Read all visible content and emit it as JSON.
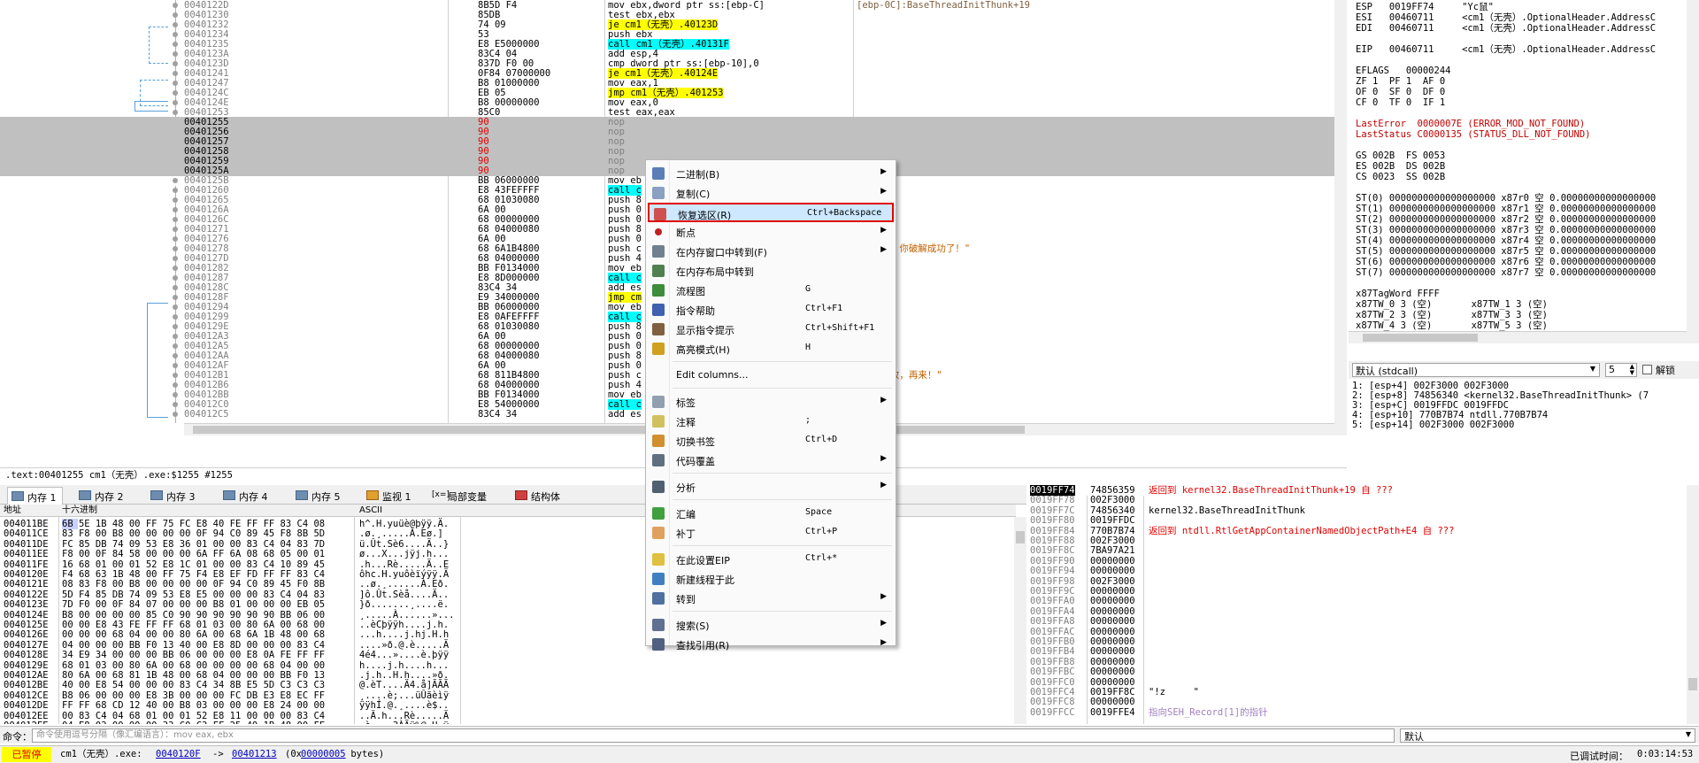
{
  "disasm": [
    {
      "addr": "0040122D",
      "hex": "8B5D F4",
      "asm": "mov ebx,dword ptr ss:[ebp-C]",
      "cmt": "[ebp-0C]:BaseThreadInitThunk+19"
    },
    {
      "addr": "00401230",
      "hex": "85DB",
      "asm": "test ebx,ebx",
      "cmt": ""
    },
    {
      "addr": "00401232",
      "hex": "74 09",
      "asm": "je cm1（无壳）.40123D",
      "cmt": ""
    },
    {
      "addr": "00401234",
      "hex": "53",
      "asm": "push ebx",
      "cmt": ""
    },
    {
      "addr": "00401235",
      "hex": "E8 E5000000",
      "asm": "call cm1（无壳）.40131F",
      "cmt": ""
    },
    {
      "addr": "0040123A",
      "hex": "83C4 04",
      "asm": "add esp,4",
      "cmt": ""
    },
    {
      "addr": "0040123D",
      "hex": "837D F0 00",
      "asm": "cmp dword ptr ss:[ebp-10],0",
      "cmt": ""
    },
    {
      "addr": "00401241",
      "hex": "0F84 07000000",
      "asm": "je cm1（无壳）.40124E",
      "cmt": ""
    },
    {
      "addr": "00401247",
      "hex": "B8 01000000",
      "asm": "mov eax,1",
      "cmt": ""
    },
    {
      "addr": "0040124C",
      "hex": "EB 05",
      "asm": "jmp cm1（无壳）.401253",
      "cmt": ""
    },
    {
      "addr": "0040124E",
      "hex": "B8 00000000",
      "asm": "mov eax,0",
      "cmt": ""
    },
    {
      "addr": "00401253",
      "hex": "85C0",
      "asm": "test eax,eax",
      "cmt": ""
    },
    {
      "addr": "00401255",
      "hex": "90",
      "asm": "nop",
      "cmt": "",
      "sel": true
    },
    {
      "addr": "00401256",
      "hex": "90",
      "asm": "nop",
      "cmt": "",
      "sel": true
    },
    {
      "addr": "00401257",
      "hex": "90",
      "asm": "nop",
      "cmt": "",
      "sel": true
    },
    {
      "addr": "00401258",
      "hex": "90",
      "asm": "nop",
      "cmt": "",
      "sel": true
    },
    {
      "addr": "00401259",
      "hex": "90",
      "asm": "nop",
      "cmt": "",
      "sel": true
    },
    {
      "addr": "0040125A",
      "hex": "90",
      "asm": "nop",
      "cmt": "",
      "sel": true
    },
    {
      "addr": "0040125B",
      "hex": "BB 06000000",
      "asm": "mov eb",
      "cmt": ""
    },
    {
      "addr": "00401260",
      "hex": "E8 43FEFFFF",
      "asm": "call c",
      "cmt": ""
    },
    {
      "addr": "00401265",
      "hex": "68 01030080",
      "asm": "push 8",
      "cmt": ""
    },
    {
      "addr": "0040126A",
      "hex": "6A 00",
      "asm": "push 0",
      "cmt": ""
    },
    {
      "addr": "0040126C",
      "hex": "68 00000000",
      "asm": "push 0",
      "cmt": ""
    },
    {
      "addr": "00401271",
      "hex": "68 04000080",
      "asm": "push 8",
      "cmt": ""
    },
    {
      "addr": "00401276",
      "hex": "6A 00",
      "asm": "push 0",
      "cmt": ""
    },
    {
      "addr": "00401278",
      "hex": "68 6A1B4800",
      "asm": "push c",
      "cmt": "\"恭喜你，你破解成功了！\""
    },
    {
      "addr": "0040127D",
      "hex": "68 04000000",
      "asm": "push 4",
      "cmt": ""
    },
    {
      "addr": "00401282",
      "hex": "BB F0134000",
      "asm": "mov eb",
      "cmt": ""
    },
    {
      "addr": "00401287",
      "hex": "E8 8D000000",
      "asm": "call c",
      "cmt": ""
    },
    {
      "addr": "0040128C",
      "hex": "83C4 34",
      "asm": "add es",
      "cmt": ""
    },
    {
      "addr": "0040128F",
      "hex": "E9 34000000",
      "asm": "jmp cm",
      "cmt": ""
    },
    {
      "addr": "00401294",
      "hex": "BB 06000000",
      "asm": "mov eb",
      "cmt": ""
    },
    {
      "addr": "00401299",
      "hex": "E8 0AFEFFFF",
      "asm": "call c",
      "cmt": ""
    },
    {
      "addr": "0040129E",
      "hex": "68 01030080",
      "asm": "push 8",
      "cmt": ""
    },
    {
      "addr": "004012A3",
      "hex": "6A 00",
      "asm": "push 0",
      "cmt": ""
    },
    {
      "addr": "004012A5",
      "hex": "68 00000000",
      "asm": "push 0",
      "cmt": ""
    },
    {
      "addr": "004012AA",
      "hex": "68 04000080",
      "asm": "push 8",
      "cmt": ""
    },
    {
      "addr": "004012AF",
      "hex": "6A 00",
      "asm": "push 0",
      "cmt": ""
    },
    {
      "addr": "004012B1",
      "hex": "68 811B4800",
      "asm": "push c",
      "cmt": "\"登录失败，再来！\""
    },
    {
      "addr": "004012B6",
      "hex": "68 04000000",
      "asm": "push 4",
      "cmt": ""
    },
    {
      "addr": "004012BB",
      "hex": "BB F0134000",
      "asm": "mov eb",
      "cmt": ""
    },
    {
      "addr": "004012C0",
      "hex": "E8 54000000",
      "asm": "call c",
      "cmt": ""
    },
    {
      "addr": "004012C5",
      "hex": "83C4 34",
      "asm": "add es",
      "cmt": ""
    }
  ],
  "registers": [
    "ESP   0019FF74     \"Yc鼠\"",
    "ESI   00460711     <cm1（无壳）.OptionalHeader.AddressC",
    "EDI   00460711     <cm1（无壳）.OptionalHeader.AddressC",
    "",
    "EIP   00460711     <cm1（无壳）.OptionalHeader.AddressC",
    "",
    "EFLAGS   00000244",
    "ZF 1  PF 1  AF 0",
    "OF 0  SF 0  DF 0",
    "CF 0  TF 0  IF 1",
    "",
    "LastError  0000007E (ERROR_MOD_NOT_FOUND)",
    "LastStatus C0000135 (STATUS_DLL_NOT_FOUND)",
    "",
    "GS 002B  FS 0053",
    "ES 002B  DS 002B",
    "CS 0023  SS 002B",
    "",
    "ST(0) 0000000000000000000 x87r0 空 0.00000000000000000",
    "ST(1) 0000000000000000000 x87r1 空 0.00000000000000000",
    "ST(2) 0000000000000000000 x87r2 空 0.00000000000000000",
    "ST(3) 0000000000000000000 x87r3 空 0.00000000000000000",
    "ST(4) 0000000000000000000 x87r4 空 0.00000000000000000",
    "ST(5) 0000000000000000000 x87r5 空 0.00000000000000000",
    "ST(6) 0000000000000000000 x87r6 空 0.00000000000000000",
    "ST(7) 0000000000000000000 x87r7 空 0.00000000000000000",
    "",
    "x87TagWord FFFF",
    "x87TW_0 3 (空)       x87TW_1 3 (空)",
    "x87TW_2 3 (空)       x87TW_3 3 (空)",
    "x87TW_4 3 (空)       x87TW_5 3 (空)",
    "x87TW_6 3 (空)       x87TW_7 3 (空)"
  ],
  "callconv": {
    "value": "默认 (stdcall)",
    "count": "5",
    "unwind": "解锁"
  },
  "args": [
    "1: [esp+4] 002F3000 002F3000",
    "2: [esp+8] 74856340 <kernel32.BaseThreadInitThunk> (7",
    "3: [esp+C] 0019FFDC 0019FFDC",
    "4: [esp+10] 770B7B74 ntdll.770B7B74",
    "5: [esp+14] 002F3000 002F3000"
  ],
  "infoline": ".text:00401255 cm1（无壳）.exe:$1255 #1255",
  "tabs": [
    {
      "label": "内存 1",
      "active": true
    },
    {
      "label": "内存 2"
    },
    {
      "label": "内存 3"
    },
    {
      "label": "内存 4"
    },
    {
      "label": "内存 5"
    },
    {
      "label": "监视 1"
    },
    {
      "label": "局部变量",
      "prefix": "[x=]"
    },
    {
      "label": "结构体"
    }
  ],
  "dump_headers": {
    "addr": "地址",
    "hex": "十六进制",
    "ascii": "ASCII"
  },
  "dump": [
    {
      "a": "004011BE",
      "h": "6B 5E 1B 48 00 FF 75 FC E8 40 FE FF FF 83 C4 08",
      "s": "h^.H.yuüè@þÿÿ.Ä."
    },
    {
      "a": "004011CE",
      "h": "83 F8 00 B8 00 00 00 00 0F 94 C0 89 45 F8 8B 5D",
      "s": ".ø.¸.....À.Eø.]"
    },
    {
      "a": "004011DE",
      "h": "FC 85 DB 74 09 53 E8 36 01 00 00 83 C4 04 83 7D",
      "s": "ü.Ût.Sè6....Ä..}"
    },
    {
      "a": "004011EE",
      "h": "F8 00 0F 84 58 00 00 00 6A FF 6A 08 68 05 00 01",
      "s": "ø...X...jÿj.h..."
    },
    {
      "a": "004011FE",
      "h": "16 68 01 00 01 52 E8 1C 01 00 00 83 C4 10 89 45",
      "s": ".h...Rè.....Ä..E"
    },
    {
      "a": "0040120E",
      "h": "F4 68 63 1B 48 00 FF 75 F4 E8 EF FD FF FF 83 C4",
      "s": "ôhc.H.yuôèïýÿÿ.Ä"
    },
    {
      "a": "0040121E",
      "h": "08 83 F8 00 B8 00 00 00 00 0F 94 C0 89 45 F0 8B",
      "s": "..ø.¸......À.Eð."
    },
    {
      "a": "0040122E",
      "h": "5D F4 85 DB 74 09 53 E8 E5 00 00 00 83 C4 04 83",
      "s": "]ô.Ût.Sèå....Ä.."
    },
    {
      "a": "0040123E",
      "h": "7D F0 00 0F 84 07 00 00 00 B8 01 00 00 00 EB 05",
      "s": "}ð.......¸....ë."
    },
    {
      "a": "0040124E",
      "h": "B8 00 00 00 00 85 C0 90 90 90 90 90 90 BB 06 00",
      "s": "¸.....À......»..."
    },
    {
      "a": "0040125E",
      "h": "00 00 E8 43 FE FF FF 68 01 03 00 80 6A 00 68 00",
      "s": "..èCþÿÿh....j.h."
    },
    {
      "a": "0040126E",
      "h": "00 00 00 68 04 00 00 80 6A 00 68 6A 1B 48 00 68",
      "s": "...h....j.hj.H.h"
    },
    {
      "a": "0040127E",
      "h": "04 00 00 00 BB F0 13 40 00 E8 8D 00 00 00 83 C4",
      "s": "....»ð.@.è.....Ä"
    },
    {
      "a": "0040128E",
      "h": "34 E9 34 00 00 00 BB 06 00 00 00 E8 0A FE FF FF",
      "s": "4é4...»....è.þÿÿ"
    },
    {
      "a": "0040129E",
      "h": "68 01 03 00 80 6A 00 68 00 00 00 00 68 04 00 00",
      "s": "h....j.h....h..."
    },
    {
      "a": "004012AE",
      "h": "80 6A 00 68 81 1B 48 00 68 04 00 00 00 BB F0 13",
      "s": ".j.h..H.h....»ð."
    },
    {
      "a": "004012BE",
      "h": "40 00 E8 54 00 00 00 83 C4 34 8B E5 5D C3 C3 C3",
      "s": "@.èT....Ä4.å]ÃÃÃ"
    },
    {
      "a": "004012CE",
      "h": "B8 06 00 00 00 E8 3B 00 00 00 FC DB E3 E8 EC FF",
      "s": "¸....è;...üÛãèìÿ"
    },
    {
      "a": "004012DE",
      "h": "FF FF 68 CD 12 40 00 B8 03 00 00 00 E8 24 00 00",
      "s": "ÿÿhÍ.@.¸....è$.."
    },
    {
      "a": "004012EE",
      "h": "00 83 C4 04 68 01 00 01 52 E8 11 00 00 00 83 C4",
      "s": "..Ä.h...Rè.....Ä"
    },
    {
      "a": "004012FE",
      "h": "04 E8 03 00 00 00 33 C0 C3 FF 25 40 1B 48 00 FF",
      "s": ".è....3ÀÃÿ%@.H.ÿ"
    }
  ],
  "stack": [
    {
      "a": "0019FF74",
      "v": "74856359",
      "c": "返回到 kernel32.BaseThreadInitThunk+19 自 ???",
      "top": true
    },
    {
      "a": "0019FF78",
      "v": "002F3000",
      "c": ""
    },
    {
      "a": "0019FF7C",
      "v": "74856340",
      "c": "kernel32.BaseThreadInitThunk"
    },
    {
      "a": "0019FF80",
      "v": "0019FFDC",
      "c": ""
    },
    {
      "a": "0019FF84",
      "v": "770B7B74",
      "c": "返回到 ntdll.RtlGetAppContainerNamedObjectPath+E4 自 ???"
    },
    {
      "a": "0019FF88",
      "v": "002F3000",
      "c": ""
    },
    {
      "a": "0019FF8C",
      "v": "7BA97A21",
      "c": ""
    },
    {
      "a": "0019FF90",
      "v": "00000000",
      "c": ""
    },
    {
      "a": "0019FF94",
      "v": "00000000",
      "c": ""
    },
    {
      "a": "0019FF98",
      "v": "002F3000",
      "c": ""
    },
    {
      "a": "0019FF9C",
      "v": "00000000",
      "c": ""
    },
    {
      "a": "0019FFA0",
      "v": "00000000",
      "c": ""
    },
    {
      "a": "0019FFA4",
      "v": "00000000",
      "c": ""
    },
    {
      "a": "0019FFA8",
      "v": "00000000",
      "c": ""
    },
    {
      "a": "0019FFAC",
      "v": "00000000",
      "c": ""
    },
    {
      "a": "0019FFB0",
      "v": "00000000",
      "c": ""
    },
    {
      "a": "0019FFB4",
      "v": "00000000",
      "c": ""
    },
    {
      "a": "0019FFB8",
      "v": "00000000",
      "c": ""
    },
    {
      "a": "0019FFBC",
      "v": "00000000",
      "c": ""
    },
    {
      "a": "0019FFC0",
      "v": "00000000",
      "c": ""
    },
    {
      "a": "0019FFC4",
      "v": "0019FF8C",
      "c": "\"!z\t\""
    },
    {
      "a": "0019FFC8",
      "v": "00000000",
      "c": ""
    },
    {
      "a": "0019FFCC",
      "v": "0019FFE4",
      "c": "指向SEH_Record[1]的指针"
    }
  ],
  "cmdbar": {
    "label": "命令：",
    "placeholder": "命令使用逗号分隔（像汇编语言）：mov eax, ebx",
    "default": "默认"
  },
  "statusbar": {
    "state": "已暂停",
    "module": "cm1（无壳）.exe:",
    "from": "0040120F",
    "arrow": "->",
    "to": "00401213",
    "size_prefix": "(0x",
    "size": "00000005",
    "size_suffix": " bytes)",
    "time_label": "已调试时间：",
    "time": "0:03:14:53"
  },
  "menu": [
    {
      "label": "二进制(B)",
      "arrow": true,
      "icon": "binary-icon",
      "color": "#5a7fb8"
    },
    {
      "label": "复制(C)",
      "arrow": true,
      "icon": "copy-icon",
      "color": "#8aa0c0"
    },
    {
      "label": "恢复选区(R)",
      "short": "Ctrl+Backspace",
      "icon": "restore-icon",
      "color": "#d05050",
      "hot": true
    },
    {
      "label": "断点",
      "arrow": true,
      "icon": "breakpoint-icon",
      "color": "#c02020"
    },
    {
      "label": "在内存窗口中转到(F)",
      "arrow": true,
      "icon": "memory-goto-icon",
      "color": "#708090"
    },
    {
      "label": "在内存布局中转到",
      "icon": "memory-map-icon",
      "color": "#508050"
    },
    {
      "label": "流程图",
      "short": "G",
      "icon": "graph-icon",
      "color": "#3c8c3c"
    },
    {
      "label": "指令帮助",
      "short": "Ctrl+F1",
      "icon": "help-icon",
      "color": "#4060b0"
    },
    {
      "label": "显示指令提示",
      "short": "Ctrl+Shift+F1",
      "icon": "hint-icon",
      "color": "#806040"
    },
    {
      "label": "高亮模式(H)",
      "short": "H",
      "icon": "highlight-icon",
      "color": "#d0a020"
    },
    {
      "label": "Edit columns...",
      "icon": "",
      "color": ""
    },
    {
      "label": "标签",
      "arrow": true,
      "icon": "label-icon",
      "color": "#90a0b0"
    },
    {
      "label": "注释",
      "short": ";",
      "icon": "comment-icon",
      "color": "#d0c060"
    },
    {
      "label": "切换书签",
      "short": "Ctrl+D",
      "icon": "bookmark-icon",
      "color": "#d09030"
    },
    {
      "label": "代码覆盖",
      "arrow": true,
      "icon": "coverage-icon",
      "color": "#607080"
    },
    {
      "label": "分析",
      "arrow": true,
      "icon": "analyze-icon",
      "color": "#506070"
    },
    {
      "label": "汇编",
      "short": "Space",
      "icon": "assemble-icon",
      "color": "#40a040"
    },
    {
      "label": "补丁",
      "short": "Ctrl+P",
      "icon": "patch-icon",
      "color": "#e0a060"
    },
    {
      "label": "在此设置EIP",
      "short": "Ctrl+*",
      "icon": "set-eip-icon",
      "color": "#e0c040"
    },
    {
      "label": "新建线程于此",
      "icon": "new-thread-icon",
      "color": "#4080c0"
    },
    {
      "label": "转到",
      "arrow": true,
      "icon": "goto-icon",
      "color": "#5070a0"
    },
    {
      "label": "搜索(S)",
      "arrow": true,
      "icon": "search-icon",
      "color": "#607090"
    },
    {
      "label": "查找引用(R)",
      "arrow": true,
      "icon": "find-refs-icon",
      "color": "#506080"
    }
  ]
}
